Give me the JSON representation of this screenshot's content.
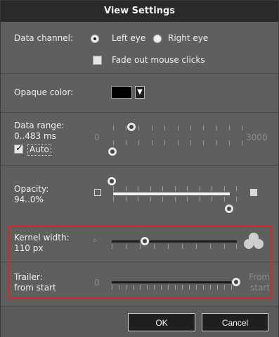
{
  "dialog": {
    "title": "View Settings"
  },
  "data_channel": {
    "label": "Data channel:",
    "options": [
      "Left eye",
      "Right eye"
    ],
    "selected": "Left eye",
    "fade_label": "Fade out mouse clicks",
    "fade_checked": false
  },
  "opaque_color": {
    "label": "Opaque color:",
    "value": "#000000"
  },
  "data_range": {
    "label": "Data range:",
    "value": "0..483 ms",
    "min_label": "0",
    "max_label": "3000",
    "auto_label": "Auto",
    "auto_checked": true,
    "low": 0,
    "high": 483,
    "max": 3000
  },
  "opacity": {
    "label": "Opacity:",
    "value": "94..0%",
    "low_percent": 0,
    "high_percent": 94
  },
  "kernel_width": {
    "label": "Kernel width:",
    "value": "110 px",
    "position_fraction": 0.25
  },
  "trailer": {
    "label": "Trailer:",
    "value": "from start",
    "min_label": "0",
    "max_label": "From start",
    "position_fraction": 1.0
  },
  "buttons": {
    "ok": "OK",
    "cancel": "Cancel"
  },
  "colors": {
    "highlight": "#d9262b",
    "title_bg": "#2a2a2a",
    "panel_bg": "#5f5f5f"
  }
}
